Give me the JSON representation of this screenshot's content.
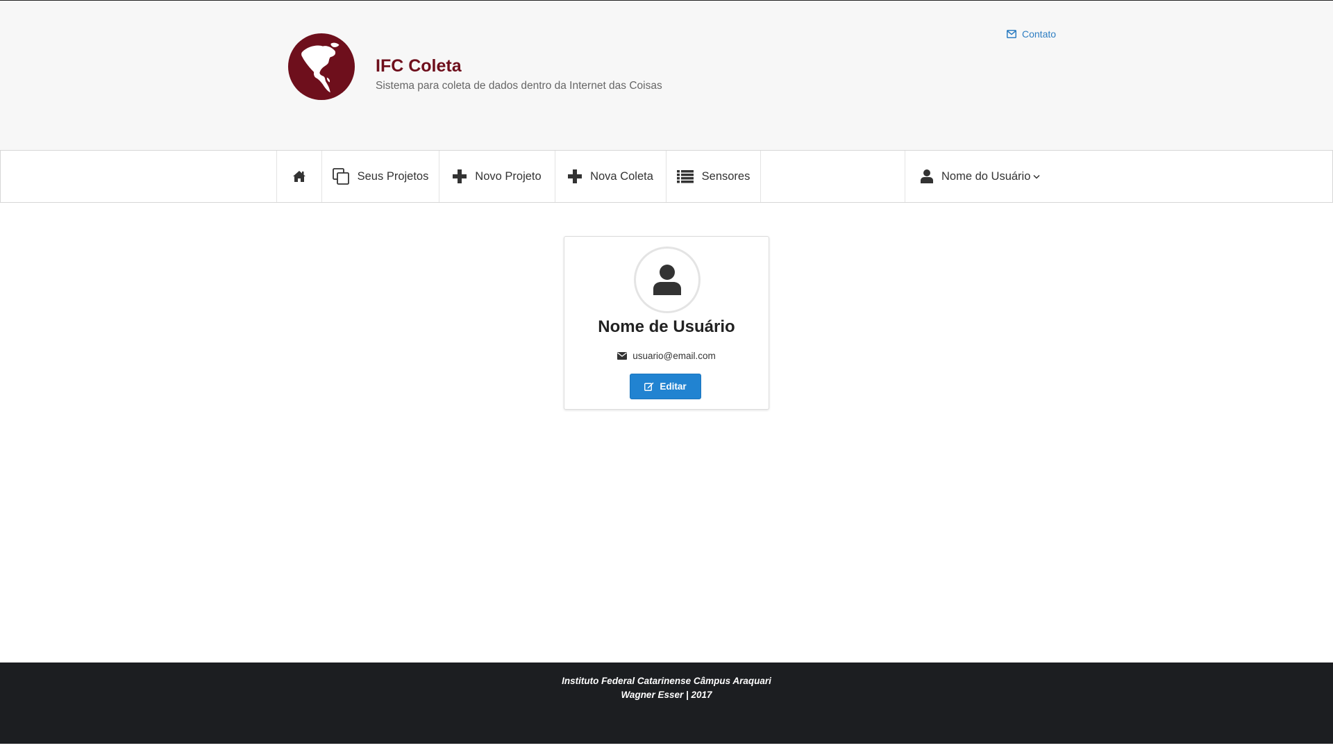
{
  "header": {
    "title": "IFC Coleta",
    "subtitle": "Sistema para coleta de dados dentro da Internet das Coisas",
    "contact_label": "Contato",
    "logo_icon": "globe-americas-icon",
    "brand_color": "#6e0f1c"
  },
  "nav": {
    "items": [
      {
        "label": "",
        "icon": "home-icon"
      },
      {
        "label": "Seus Projetos",
        "icon": "clone-icon"
      },
      {
        "label": "Novo Projeto",
        "icon": "plus-icon"
      },
      {
        "label": "Nova Coleta",
        "icon": "plus-icon"
      },
      {
        "label": "Sensores",
        "icon": "list-icon"
      }
    ],
    "user_menu": {
      "label": "Nome do Usuário",
      "icon": "user-icon",
      "caret": "chevron-down-icon"
    }
  },
  "profile": {
    "name": "Nome de Usuário",
    "email": "usuario@email.com",
    "edit_label": "Editar",
    "avatar_icon": "user-icon",
    "button_color": "#2183d1"
  },
  "footer": {
    "line1": "Instituto Federal Catarinense Câmpus Araquari",
    "line2": "Wagner Esser | 2017"
  }
}
